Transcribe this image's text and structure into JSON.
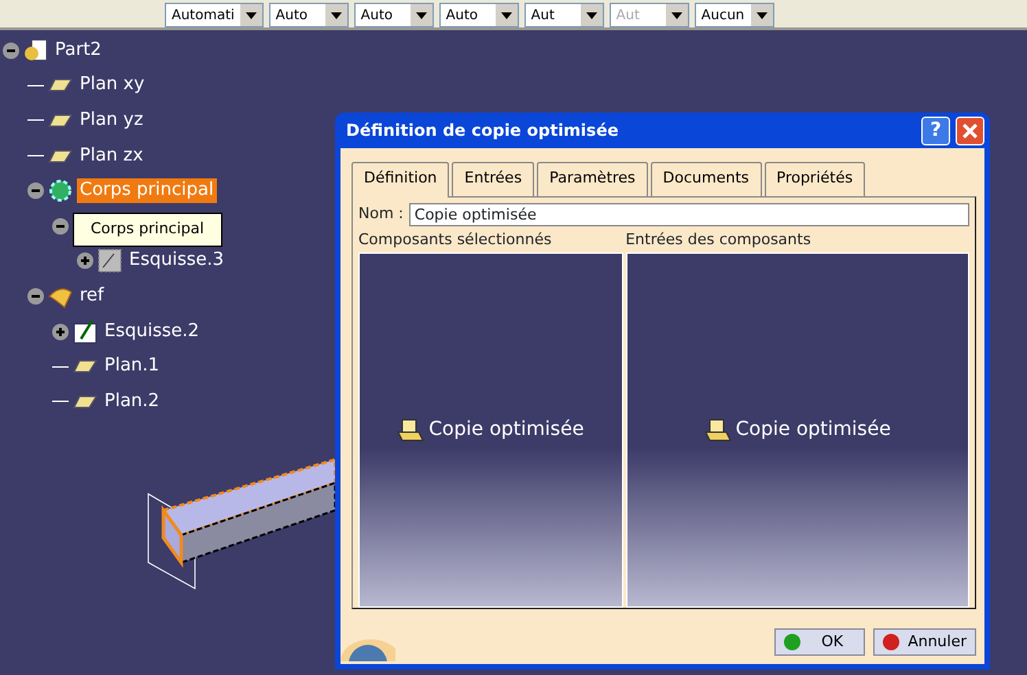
{
  "toolbar": {
    "combos": [
      {
        "value": "Automati",
        "disabled": false
      },
      {
        "value": "Auto",
        "disabled": false
      },
      {
        "value": "Auto",
        "disabled": false
      },
      {
        "value": "Auto",
        "disabled": false
      },
      {
        "value": "Aut",
        "disabled": false
      },
      {
        "value": "Aut",
        "disabled": true
      },
      {
        "value": "Aucun",
        "disabled": false
      }
    ]
  },
  "tree": [
    {
      "label": "Part2",
      "kind": "part",
      "selected": false,
      "expanded": true,
      "children": [
        {
          "label": "Plan xy",
          "kind": "plane",
          "selected": false
        },
        {
          "label": "Plan yz",
          "kind": "plane",
          "selected": false
        },
        {
          "label": "Plan zx",
          "kind": "plane",
          "selected": false
        },
        {
          "label": "Corps principal",
          "kind": "body",
          "selected": true,
          "expanded": true,
          "children": [
            {
              "kind": "pad",
              "expanded": true,
              "children": [
                {
                  "label": "Esquisse.3",
                  "kind": "sketch-hatched",
                  "selected": false,
                  "expanded": false
                }
              ]
            }
          ]
        },
        {
          "label": "ref",
          "kind": "set",
          "selected": false,
          "expanded": true,
          "children": [
            {
              "label": "Esquisse.2",
              "kind": "sketch",
              "selected": false,
              "expanded": false
            },
            {
              "label": "Plan.1",
              "kind": "plane",
              "selected": false
            },
            {
              "label": "Plan.2",
              "kind": "plane",
              "selected": false
            }
          ]
        }
      ]
    }
  ],
  "tooltip": "Corps principal",
  "dialog": {
    "title": "Définition de copie optimisée",
    "help_button": "?",
    "tabs": [
      {
        "label": "Définition",
        "selected": true
      },
      {
        "label": "Entrées",
        "selected": false
      },
      {
        "label": "Paramètres",
        "selected": false
      },
      {
        "label": "Documents",
        "selected": false
      },
      {
        "label": "Propriétés",
        "selected": false
      }
    ],
    "name_label": "Nom :",
    "name_value": "Copie optimisée",
    "panels": [
      {
        "heading": "Composants sélectionnés",
        "item": "Copie optimisée"
      },
      {
        "heading": "Entrées des composants",
        "item": "Copie optimisée"
      }
    ],
    "buttons": [
      {
        "label": "OK",
        "kind": "ok"
      },
      {
        "label": "Annuler",
        "kind": "cancel"
      }
    ]
  }
}
